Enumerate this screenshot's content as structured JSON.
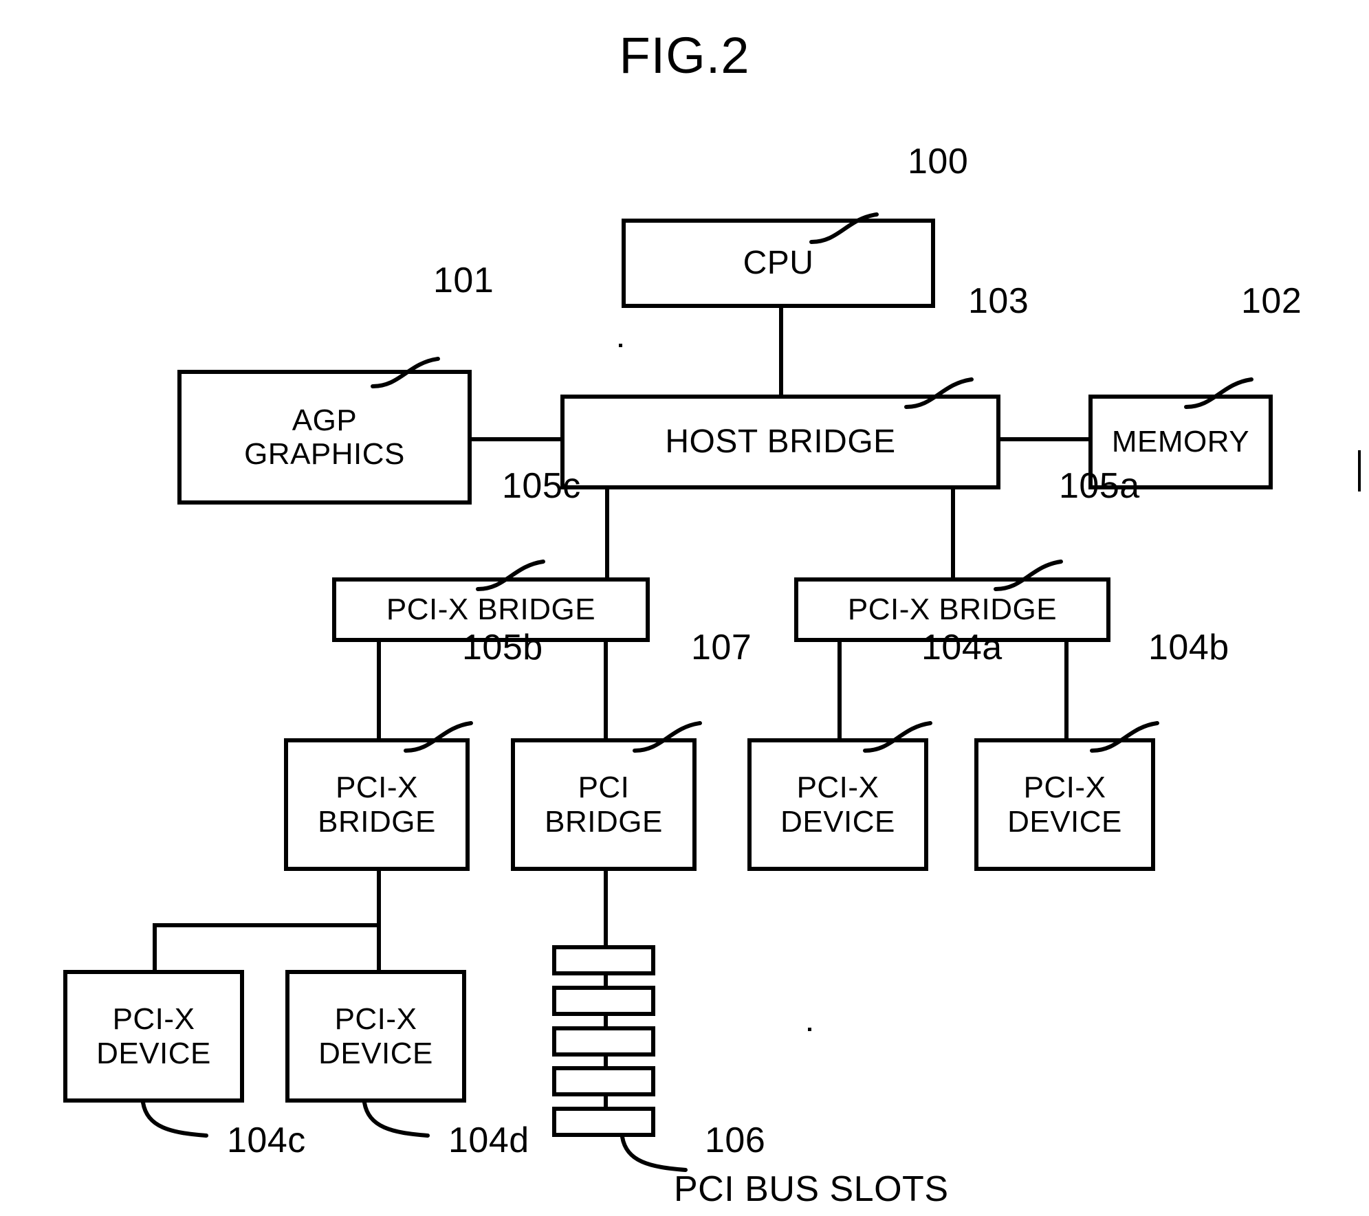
{
  "figure": {
    "title": "FIG.2",
    "caption": "PCI BUS SLOTS"
  },
  "nodes": {
    "cpu": {
      "label": "CPU",
      "ref": "100"
    },
    "agp_graphics": {
      "label": "AGP\nGRAPHICS",
      "ref": "101"
    },
    "memory": {
      "label": "MEMORY",
      "ref": "102"
    },
    "host_bridge": {
      "label": "HOST BRIDGE",
      "ref": "103"
    },
    "pcix_bridge_c": {
      "label": "PCI-X BRIDGE",
      "ref": "105c"
    },
    "pcix_bridge_a": {
      "label": "PCI-X BRIDGE",
      "ref": "105a"
    },
    "pcix_bridge_b": {
      "label": "PCI-X\nBRIDGE",
      "ref": "105b"
    },
    "pci_bridge": {
      "label": "PCI\nBRIDGE",
      "ref": "107"
    },
    "pcix_device_a": {
      "label": "PCI-X\nDEVICE",
      "ref": "104a"
    },
    "pcix_device_b": {
      "label": "PCI-X\nDEVICE",
      "ref": "104b"
    },
    "pcix_device_c": {
      "label": "PCI-X\nDEVICE",
      "ref": "104c"
    },
    "pcix_device_d": {
      "label": "PCI-X\nDEVICE",
      "ref": "104d"
    },
    "pci_bus_slots": {
      "label": "",
      "ref": "106",
      "slot_count": 5
    }
  },
  "colors": {
    "stroke": "#000000",
    "background": "#ffffff"
  }
}
